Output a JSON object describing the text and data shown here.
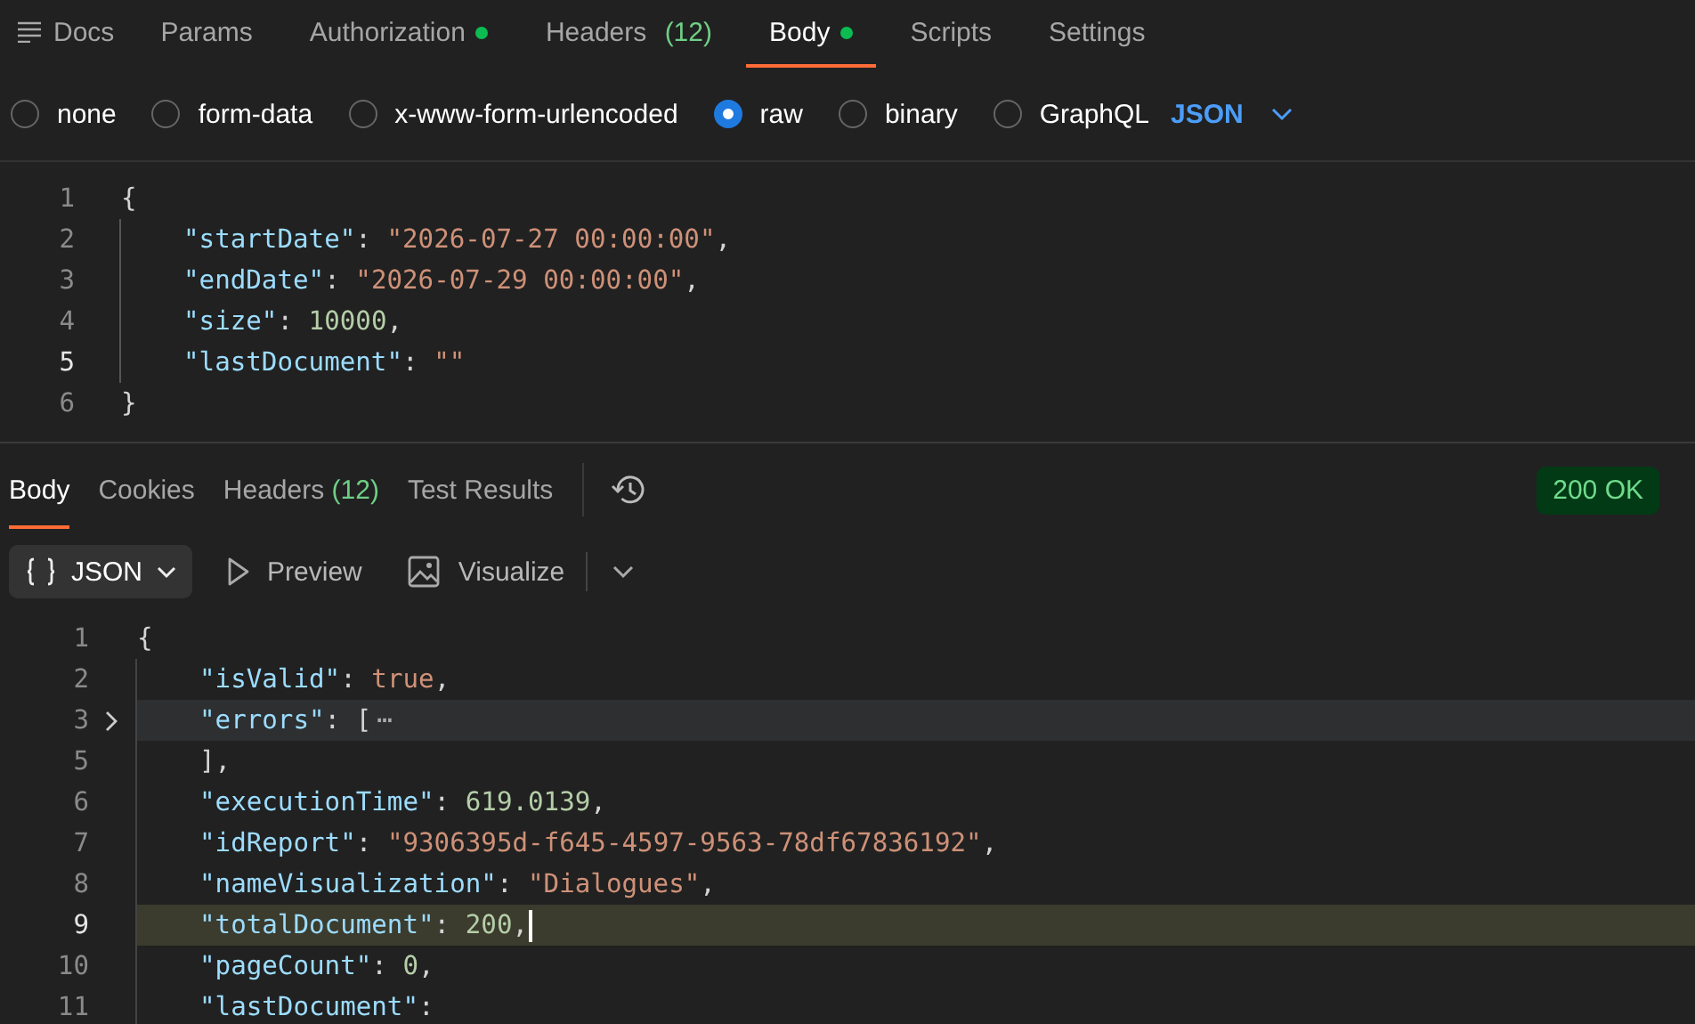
{
  "request_tabs": [
    {
      "kind": "docs",
      "label": "Docs",
      "selected": false
    },
    {
      "kind": "tab",
      "label": "Params",
      "selected": false
    },
    {
      "kind": "tab",
      "label": "Authorization",
      "dot": true,
      "selected": false
    },
    {
      "kind": "tab",
      "label": "Headers",
      "count": "(12)",
      "selected": false
    },
    {
      "kind": "tab",
      "label": "Body",
      "dot": true,
      "selected": true
    },
    {
      "kind": "tab",
      "label": "Scripts",
      "selected": false
    },
    {
      "kind": "tab",
      "label": "Settings",
      "selected": false
    }
  ],
  "body_types": [
    {
      "label": "none",
      "selected": false
    },
    {
      "label": "form-data",
      "selected": false
    },
    {
      "label": "x-www-form-urlencoded",
      "selected": false
    },
    {
      "label": "raw",
      "selected": true
    },
    {
      "label": "binary",
      "selected": false
    },
    {
      "label": "GraphQL",
      "selected": false
    }
  ],
  "raw_format": "JSON",
  "request_code": [
    {
      "number": "1",
      "current": false,
      "tokens": [
        {
          "kind": "punct",
          "text": "{"
        }
      ],
      "children": [
        {
          "number": "2",
          "current": false,
          "tokens": [
            {
              "kind": "key",
              "text": "\"startDate\""
            },
            {
              "kind": "punct",
              "text": ": "
            },
            {
              "kind": "string",
              "text": "\"2026-07-27 00:00:00\""
            },
            {
              "kind": "punct",
              "text": ","
            }
          ]
        },
        {
          "number": "3",
          "current": false,
          "tokens": [
            {
              "kind": "key",
              "text": "\"endDate\""
            },
            {
              "kind": "punct",
              "text": ": "
            },
            {
              "kind": "string",
              "text": "\"2026-07-29 00:00:00\""
            },
            {
              "kind": "punct",
              "text": ","
            }
          ]
        },
        {
          "number": "4",
          "current": false,
          "tokens": [
            {
              "kind": "key",
              "text": "\"size\""
            },
            {
              "kind": "punct",
              "text": ": "
            },
            {
              "kind": "number",
              "text": "10000"
            },
            {
              "kind": "punct",
              "text": ","
            }
          ]
        },
        {
          "number": "5",
          "current": true,
          "tokens": [
            {
              "kind": "key",
              "text": "\"lastDocument\""
            },
            {
              "kind": "punct",
              "text": ": "
            },
            {
              "kind": "string",
              "text": "\"\""
            }
          ]
        }
      ]
    },
    {
      "number": "6",
      "current": false,
      "tokens": [
        {
          "kind": "punct",
          "text": "}"
        }
      ]
    }
  ],
  "response_tabs": [
    {
      "label": "Body",
      "selected": true
    },
    {
      "label": "Cookies",
      "selected": false
    },
    {
      "label": "Headers",
      "count": "(12)",
      "selected": false
    },
    {
      "label": "Test Results",
      "selected": false
    }
  ],
  "status": "200 OK",
  "response_format": "JSON",
  "preview": "Preview",
  "visualize": "Visualize",
  "response_code": [
    {
      "number": "1",
      "current": false,
      "tokens": [
        {
          "kind": "punct",
          "text": "{"
        }
      ],
      "children": [
        {
          "number": "2",
          "current": false,
          "tokens": [
            {
              "kind": "key",
              "text": "\"isValid\""
            },
            {
              "kind": "punct",
              "text": ": "
            },
            {
              "kind": "bool",
              "text": "true"
            },
            {
              "kind": "punct",
              "text": ","
            }
          ]
        },
        {
          "number": "3",
          "current": false,
          "collapsed": true,
          "tokens": [
            {
              "kind": "key",
              "text": "\"errors\""
            },
            {
              "kind": "punct",
              "text": ": ["
            },
            {
              "kind": "fold",
              "text": "⋯"
            }
          ]
        },
        {
          "number": "5",
          "current": false,
          "tokens": [
            {
              "kind": "punct",
              "text": "],"
            }
          ]
        },
        {
          "number": "6",
          "current": false,
          "tokens": [
            {
              "kind": "key",
              "text": "\"executionTime\""
            },
            {
              "kind": "punct",
              "text": ": "
            },
            {
              "kind": "number",
              "text": "619.0139"
            },
            {
              "kind": "punct",
              "text": ","
            }
          ]
        },
        {
          "number": "7",
          "current": false,
          "tokens": [
            {
              "kind": "key",
              "text": "\"idReport\""
            },
            {
              "kind": "punct",
              "text": ": "
            },
            {
              "kind": "string",
              "text": "\"9306395d-f645-4597-9563-78df67836192\""
            },
            {
              "kind": "punct",
              "text": ","
            }
          ]
        },
        {
          "number": "8",
          "current": false,
          "tokens": [
            {
              "kind": "key",
              "text": "\"nameVisualization\""
            },
            {
              "kind": "punct",
              "text": ": "
            },
            {
              "kind": "string",
              "text": "\"Dialogues\""
            },
            {
              "kind": "punct",
              "text": ","
            }
          ]
        },
        {
          "number": "9",
          "current": true,
          "tokens": [
            {
              "kind": "key",
              "text": "\"totalDocument\""
            },
            {
              "kind": "punct",
              "text": ": "
            },
            {
              "kind": "number",
              "text": "200"
            },
            {
              "kind": "punct",
              "text": ","
            }
          ]
        },
        {
          "number": "10",
          "current": false,
          "tokens": [
            {
              "kind": "key",
              "text": "\"pageCount\""
            },
            {
              "kind": "punct",
              "text": ": "
            },
            {
              "kind": "number",
              "text": "0"
            },
            {
              "kind": "punct",
              "text": ","
            }
          ]
        },
        {
          "number": "11",
          "current": false,
          "tokens": [
            {
              "kind": "key",
              "text": "\"lastDocument\""
            },
            {
              "kind": "punct",
              "text": ":"
            }
          ]
        }
      ]
    }
  ]
}
